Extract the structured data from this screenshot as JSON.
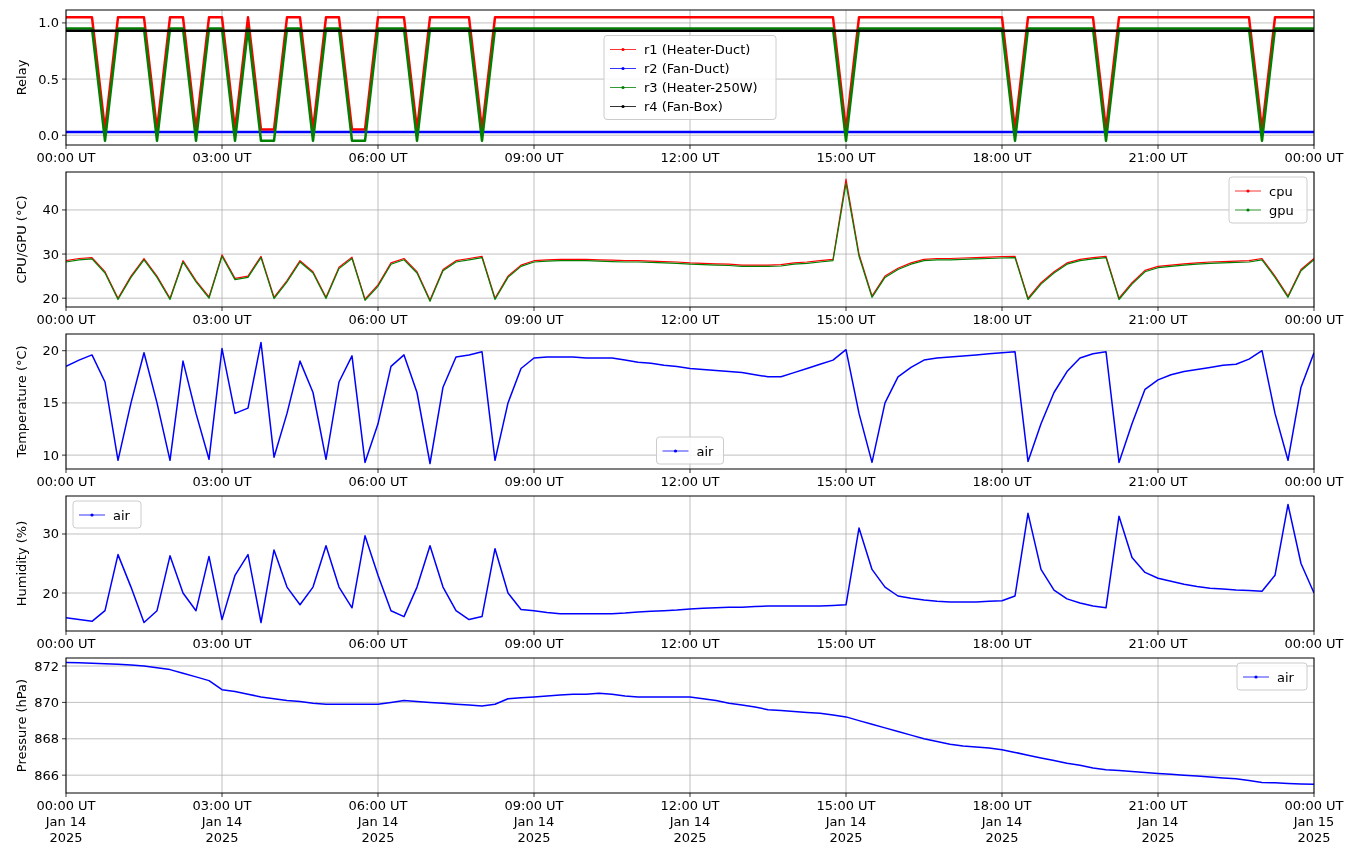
{
  "panels": [
    {
      "chart_data": {
        "type": "line",
        "grid": true,
        "legend": true,
        "ylabel": "Relay",
        "ylim": [
          -0.087,
          1.115
        ],
        "categories": [
          "00:00 UT",
          null,
          null,
          null,
          null,
          null,
          null,
          null,
          null,
          null,
          null,
          null,
          "03:00 UT",
          null,
          null,
          null,
          null,
          null,
          null,
          null,
          null,
          null,
          null,
          null,
          "06:00 UT",
          null,
          null,
          null,
          null,
          null,
          null,
          null,
          null,
          null,
          null,
          null,
          "09:00 UT",
          null,
          null,
          null,
          null,
          null,
          null,
          null,
          null,
          null,
          null,
          null,
          "12:00 UT",
          null,
          null,
          null,
          null,
          null,
          null,
          null,
          null,
          null,
          null,
          null,
          "15:00 UT",
          null,
          null,
          null,
          null,
          null,
          null,
          null,
          null,
          null,
          null,
          null,
          "18:00 UT",
          null,
          null,
          null,
          null,
          null,
          null,
          null,
          null,
          null,
          null,
          null,
          "21:00 UT",
          null,
          null,
          null,
          null,
          null,
          null,
          null,
          null,
          null,
          null,
          null,
          "00:00 UT"
        ],
        "yticks": [
          {
            "value": 0,
            "label": "0.0"
          },
          {
            "value": 0.5,
            "label": "0.5"
          },
          {
            "value": 1,
            "label": "1.0"
          }
        ],
        "series": [
          {
            "name": "r1 (Heater-Duct)",
            "color": "#ff0000",
            "values": [
              1.05,
              1.05,
              1.05,
              0.05,
              1.05,
              1.05,
              1.05,
              0.05,
              1.05,
              1.05,
              0.05,
              1.05,
              1.05,
              0.05,
              1.05,
              0.05,
              0.05,
              1.05,
              1.05,
              0.05,
              1.05,
              1.05,
              0.05,
              0.05,
              1.05,
              1.05,
              1.05,
              0.05,
              1.05,
              1.05,
              1.05,
              1.05,
              0.05,
              1.05,
              1.05,
              1.05,
              1.05,
              1.05,
              1.05,
              1.05,
              1.05,
              1.05,
              1.05,
              1.05,
              1.05,
              1.05,
              1.05,
              1.05,
              1.05,
              1.05,
              1.05,
              1.05,
              1.05,
              1.05,
              1.05,
              1.05,
              1.05,
              1.05,
              1.05,
              1.05,
              0.05,
              1.05,
              1.05,
              1.05,
              1.05,
              1.05,
              1.05,
              1.05,
              1.05,
              1.05,
              1.05,
              1.05,
              1.05,
              0.05,
              1.05,
              1.05,
              1.05,
              1.05,
              1.05,
              1.05,
              0.05,
              1.05,
              1.05,
              1.05,
              1.05,
              1.05,
              1.05,
              1.05,
              1.05,
              1.05,
              1.05,
              1.05,
              0.05,
              1.05,
              1.05,
              1.05,
              1.05
            ]
          },
          {
            "name": "r2 (Fan-Duct)",
            "color": "#0000ff",
            "values": [
              0.03,
              0.03,
              0.03,
              0.03,
              0.03,
              0.03,
              0.03,
              0.03,
              0.03,
              0.03,
              0.03,
              0.03,
              0.03,
              0.03,
              0.03,
              0.03,
              0.03,
              0.03,
              0.03,
              0.03,
              0.03,
              0.03,
              0.03,
              0.03,
              0.03,
              0.03,
              0.03,
              0.03,
              0.03,
              0.03,
              0.03,
              0.03,
              0.03,
              0.03,
              0.03,
              0.03,
              0.03,
              0.03,
              0.03,
              0.03,
              0.03,
              0.03,
              0.03,
              0.03,
              0.03,
              0.03,
              0.03,
              0.03,
              0.03,
              0.03,
              0.03,
              0.03,
              0.03,
              0.03,
              0.03,
              0.03,
              0.03,
              0.03,
              0.03,
              0.03,
              0.03,
              0.03,
              0.03,
              0.03,
              0.03,
              0.03,
              0.03,
              0.03,
              0.03,
              0.03,
              0.03,
              0.03,
              0.03,
              0.03,
              0.03,
              0.03,
              0.03,
              0.03,
              0.03,
              0.03,
              0.03,
              0.03,
              0.03,
              0.03,
              0.03,
              0.03,
              0.03,
              0.03,
              0.03,
              0.03,
              0.03,
              0.03,
              0.03,
              0.03,
              0.03,
              0.03,
              0.03
            ]
          },
          {
            "name": "r3 (Heater-250W)",
            "color": "#008000",
            "values": [
              0.95,
              0.95,
              0.95,
              -0.05,
              0.95,
              0.95,
              0.95,
              -0.05,
              0.95,
              0.95,
              -0.05,
              0.95,
              0.95,
              -0.05,
              0.95,
              -0.05,
              -0.05,
              0.95,
              0.95,
              -0.05,
              0.95,
              0.95,
              -0.05,
              -0.05,
              0.95,
              0.95,
              0.95,
              -0.05,
              0.95,
              0.95,
              0.95,
              0.95,
              -0.05,
              0.95,
              0.95,
              0.95,
              0.95,
              0.95,
              0.95,
              0.95,
              0.95,
              0.95,
              0.95,
              0.95,
              0.95,
              0.95,
              0.95,
              0.95,
              0.95,
              0.95,
              0.95,
              0.95,
              0.95,
              0.95,
              0.95,
              0.95,
              0.95,
              0.95,
              0.95,
              0.95,
              -0.05,
              0.95,
              0.95,
              0.95,
              0.95,
              0.95,
              0.95,
              0.95,
              0.95,
              0.95,
              0.95,
              0.95,
              0.95,
              -0.05,
              0.95,
              0.95,
              0.95,
              0.95,
              0.95,
              0.95,
              -0.05,
              0.95,
              0.95,
              0.95,
              0.95,
              0.95,
              0.95,
              0.95,
              0.95,
              0.95,
              0.95,
              0.95,
              -0.05,
              0.95,
              0.95,
              0.95,
              0.95
            ]
          },
          {
            "name": "r4 (Fan-Box)",
            "color": "#000000",
            "values": [
              0.93,
              0.93,
              0.93,
              0.93,
              0.93,
              0.93,
              0.93,
              0.93,
              0.93,
              0.93,
              0.93,
              0.93,
              0.93,
              0.93,
              0.93,
              0.93,
              0.93,
              0.93,
              0.93,
              0.93,
              0.93,
              0.93,
              0.93,
              0.93,
              0.93,
              0.93,
              0.93,
              0.93,
              0.93,
              0.93,
              0.93,
              0.93,
              0.93,
              0.93,
              0.93,
              0.93,
              0.93,
              0.93,
              0.93,
              0.93,
              0.93,
              0.93,
              0.93,
              0.93,
              0.93,
              0.93,
              0.93,
              0.93,
              0.93,
              0.93,
              0.93,
              0.93,
              0.93,
              0.93,
              0.93,
              0.93,
              0.93,
              0.93,
              0.93,
              0.93,
              0.93,
              0.93,
              0.93,
              0.93,
              0.93,
              0.93,
              0.93,
              0.93,
              0.93,
              0.93,
              0.93,
              0.93,
              0.93,
              0.93,
              0.93,
              0.93,
              0.93,
              0.93,
              0.93,
              0.93,
              0.93,
              0.93,
              0.93,
              0.93,
              0.93,
              0.93,
              0.93,
              0.93,
              0.93,
              0.93,
              0.93,
              0.93,
              0.93,
              0.93,
              0.93,
              0.93,
              0.93
            ]
          }
        ]
      }
    },
    {
      "chart_data": {
        "type": "line",
        "grid": true,
        "legend": true,
        "ylabel": "CPU/GPU (°C)",
        "ylim": [
          18.0,
          48.6
        ],
        "categories": [
          "00:00 UT",
          null,
          null,
          null,
          null,
          null,
          null,
          null,
          null,
          null,
          null,
          null,
          "03:00 UT",
          null,
          null,
          null,
          null,
          null,
          null,
          null,
          null,
          null,
          null,
          null,
          "06:00 UT",
          null,
          null,
          null,
          null,
          null,
          null,
          null,
          null,
          null,
          null,
          null,
          "09:00 UT",
          null,
          null,
          null,
          null,
          null,
          null,
          null,
          null,
          null,
          null,
          null,
          "12:00 UT",
          null,
          null,
          null,
          null,
          null,
          null,
          null,
          null,
          null,
          null,
          null,
          "15:00 UT",
          null,
          null,
          null,
          null,
          null,
          null,
          null,
          null,
          null,
          null,
          null,
          "18:00 UT",
          null,
          null,
          null,
          null,
          null,
          null,
          null,
          null,
          null,
          null,
          null,
          "21:00 UT",
          null,
          null,
          null,
          null,
          null,
          null,
          null,
          null,
          null,
          null,
          null,
          "00:00 UT"
        ],
        "yticks": [
          20,
          30,
          40
        ],
        "series": [
          {
            "name": "cpu",
            "color": "#ff0000",
            "values": [
              28.5,
              29,
              29.2,
              26,
              20,
              25,
              29,
              25,
              20,
              28.5,
              24,
              20.3,
              29.8,
              24.5,
              25,
              29.5,
              20.2,
              24,
              28.5,
              26,
              20.2,
              27,
              29.3,
              19.8,
              23,
              28,
              29,
              26,
              19.6,
              26.5,
              28.5,
              29,
              29.5,
              20,
              25,
              27.5,
              28.5,
              28.7,
              28.8,
              28.8,
              28.8,
              28.7,
              28.6,
              28.5,
              28.5,
              28.4,
              28.3,
              28.2,
              28,
              27.9,
              27.8,
              27.7,
              27.5,
              27.5,
              27.5,
              27.6,
              28,
              28.2,
              28.5,
              28.8,
              47,
              30,
              20.5,
              25,
              26.8,
              28,
              28.8,
              29,
              29,
              29.1,
              29.2,
              29.3,
              29.4,
              29.5,
              20,
              23.5,
              26,
              28,
              28.8,
              29.2,
              29.5,
              20,
              23.5,
              26.3,
              27.2,
              27.5,
              27.8,
              28,
              28.2,
              28.3,
              28.4,
              28.5,
              29,
              25,
              20.5,
              26.5,
              29
            ]
          },
          {
            "name": "gpu",
            "color": "#008000",
            "values": [
              28.2,
              28.7,
              28.9,
              25.7,
              19.7,
              24.7,
              28.7,
              24.7,
              19.7,
              28.2,
              23.7,
              20,
              29.5,
              24.2,
              24.7,
              29.2,
              19.9,
              23.7,
              28.2,
              25.7,
              19.9,
              26.7,
              29,
              19.5,
              22.7,
              27.7,
              28.7,
              25.7,
              19.3,
              26.2,
              28.2,
              28.7,
              29.2,
              19.7,
              24.7,
              27.2,
              28.2,
              28.4,
              28.5,
              28.5,
              28.5,
              28.4,
              28.3,
              28.2,
              28.2,
              28.1,
              28,
              27.9,
              27.7,
              27.6,
              27.5,
              27.4,
              27.2,
              27.2,
              27.2,
              27.3,
              27.7,
              27.9,
              28.2,
              28.5,
              46,
              29.5,
              20.2,
              24.7,
              26.5,
              27.7,
              28.5,
              28.7,
              28.7,
              28.8,
              28.9,
              29,
              29.1,
              29.2,
              19.7,
              23.2,
              25.7,
              27.7,
              28.5,
              28.9,
              29.2,
              19.7,
              23.2,
              26,
              26.9,
              27.2,
              27.5,
              27.7,
              27.9,
              28,
              28.1,
              28.2,
              28.7,
              24.7,
              20.2,
              26.2,
              28.7
            ]
          }
        ]
      }
    },
    {
      "chart_data": {
        "type": "line",
        "grid": true,
        "legend": true,
        "ylabel": "Temperature (°C)",
        "ylim": [
          8.67,
          21.6
        ],
        "categories": [
          "00:00 UT",
          null,
          null,
          null,
          null,
          null,
          null,
          null,
          null,
          null,
          null,
          null,
          "03:00 UT",
          null,
          null,
          null,
          null,
          null,
          null,
          null,
          null,
          null,
          null,
          null,
          "06:00 UT",
          null,
          null,
          null,
          null,
          null,
          null,
          null,
          null,
          null,
          null,
          null,
          "09:00 UT",
          null,
          null,
          null,
          null,
          null,
          null,
          null,
          null,
          null,
          null,
          null,
          "12:00 UT",
          null,
          null,
          null,
          null,
          null,
          null,
          null,
          null,
          null,
          null,
          null,
          "15:00 UT",
          null,
          null,
          null,
          null,
          null,
          null,
          null,
          null,
          null,
          null,
          null,
          "18:00 UT",
          null,
          null,
          null,
          null,
          null,
          null,
          null,
          null,
          null,
          null,
          null,
          "21:00 UT",
          null,
          null,
          null,
          null,
          null,
          null,
          null,
          null,
          null,
          null,
          null,
          "00:00 UT"
        ],
        "yticks": [
          10,
          15,
          20
        ],
        "series": [
          {
            "name": "air",
            "color": "#0000ff",
            "values": [
              18.5,
              19.1,
              19.6,
              17,
              9.5,
              15,
              19.8,
              15,
              9.5,
              19,
              14,
              9.6,
              20.2,
              14,
              14.5,
              20.8,
              9.8,
              14,
              19,
              16,
              9.6,
              17,
              19.5,
              9.3,
              13,
              18.5,
              19.6,
              16,
              9.2,
              16.5,
              19.4,
              19.6,
              19.9,
              9.5,
              15,
              18.3,
              19.3,
              19.4,
              19.4,
              19.4,
              19.3,
              19.3,
              19.3,
              19.1,
              18.9,
              18.8,
              18.6,
              18.5,
              18.3,
              18.2,
              18.1,
              18,
              17.9,
              17.7,
              17.5,
              17.5,
              17.9,
              18.3,
              18.7,
              19.1,
              20.1,
              14,
              9.3,
              15,
              17.5,
              18.4,
              19.1,
              19.3,
              19.4,
              19.5,
              19.6,
              19.7,
              19.8,
              19.9,
              9.4,
              13,
              16,
              18,
              19.3,
              19.7,
              19.9,
              9.3,
              13,
              16.3,
              17.2,
              17.7,
              18,
              18.2,
              18.4,
              18.6,
              18.7,
              19.2,
              20,
              14,
              9.5,
              16.5,
              19.8
            ]
          }
        ]
      }
    },
    {
      "chart_data": {
        "type": "line",
        "grid": true,
        "legend": true,
        "ylabel": "Humidity (%)",
        "ylim": [
          13.56,
          36.44
        ],
        "categories": [
          "00:00 UT",
          null,
          null,
          null,
          null,
          null,
          null,
          null,
          null,
          null,
          null,
          null,
          "03:00 UT",
          null,
          null,
          null,
          null,
          null,
          null,
          null,
          null,
          null,
          null,
          null,
          "06:00 UT",
          null,
          null,
          null,
          null,
          null,
          null,
          null,
          null,
          null,
          null,
          null,
          "09:00 UT",
          null,
          null,
          null,
          null,
          null,
          null,
          null,
          null,
          null,
          null,
          null,
          "12:00 UT",
          null,
          null,
          null,
          null,
          null,
          null,
          null,
          null,
          null,
          null,
          null,
          "15:00 UT",
          null,
          null,
          null,
          null,
          null,
          null,
          null,
          null,
          null,
          null,
          null,
          "18:00 UT",
          null,
          null,
          null,
          null,
          null,
          null,
          null,
          null,
          null,
          null,
          null,
          "21:00 UT",
          null,
          null,
          null,
          null,
          null,
          null,
          null,
          null,
          null,
          null,
          null,
          "00:00 UT"
        ],
        "yticks": [
          20,
          30
        ],
        "series": [
          {
            "name": "air",
            "color": "#0000ff",
            "values": [
              15.8,
              15.5,
              15.2,
              17,
              26.5,
              21,
              15,
              17,
              26.3,
              20,
              17,
              26.2,
              15.5,
              23,
              26.5,
              15,
              27.3,
              21,
              18,
              21,
              28,
              21,
              17.5,
              29.7,
              23,
              17,
              16,
              21,
              28,
              21,
              17,
              15.5,
              16,
              27.5,
              20,
              17.2,
              17,
              16.7,
              16.5,
              16.5,
              16.5,
              16.5,
              16.5,
              16.6,
              16.8,
              16.9,
              17,
              17.1,
              17.3,
              17.4,
              17.5,
              17.6,
              17.6,
              17.7,
              17.8,
              17.8,
              17.8,
              17.8,
              17.8,
              17.9,
              18,
              31,
              24,
              21,
              19.5,
              19.1,
              18.8,
              18.6,
              18.5,
              18.5,
              18.5,
              18.6,
              18.7,
              19.5,
              33.5,
              24,
              20.5,
              19,
              18.3,
              17.8,
              17.5,
              33,
              26,
              23.5,
              22.5,
              22,
              21.5,
              21.1,
              20.8,
              20.7,
              20.5,
              20.4,
              20.3,
              23,
              35,
              25,
              20
            ]
          }
        ]
      }
    },
    {
      "chart_data": {
        "type": "line",
        "grid": true,
        "legend": true,
        "ylabel": "Pressure (hPa)",
        "ylim": [
          865.02,
          872.44
        ],
        "categories": [
          "00:00 UT\nJan 14\n2025",
          null,
          null,
          null,
          null,
          null,
          null,
          null,
          null,
          null,
          null,
          null,
          "03:00 UT\nJan 14\n2025",
          null,
          null,
          null,
          null,
          null,
          null,
          null,
          null,
          null,
          null,
          null,
          "06:00 UT\nJan 14\n2025",
          null,
          null,
          null,
          null,
          null,
          null,
          null,
          null,
          null,
          null,
          null,
          "09:00 UT\nJan 14\n2025",
          null,
          null,
          null,
          null,
          null,
          null,
          null,
          null,
          null,
          null,
          null,
          "12:00 UT\nJan 14\n2025",
          null,
          null,
          null,
          null,
          null,
          null,
          null,
          null,
          null,
          null,
          null,
          "15:00 UT\nJan 14\n2025",
          null,
          null,
          null,
          null,
          null,
          null,
          null,
          null,
          null,
          null,
          null,
          "18:00 UT\nJan 14\n2025",
          null,
          null,
          null,
          null,
          null,
          null,
          null,
          null,
          null,
          null,
          null,
          "21:00 UT\nJan 14\n2025",
          null,
          null,
          null,
          null,
          null,
          null,
          null,
          null,
          null,
          null,
          null,
          "00:00 UT\nJan 15\n2025"
        ],
        "yticks": [
          866,
          868,
          870,
          872
        ],
        "series": [
          {
            "name": "air",
            "color": "#0000ff",
            "values": [
              872.2,
              872.18,
              872.15,
              872.12,
              872.1,
              872.05,
              872.0,
              871.9,
              871.8,
              871.6,
              871.4,
              871.2,
              870.7,
              870.6,
              870.45,
              870.3,
              870.2,
              870.1,
              870.05,
              869.95,
              869.9,
              869.9,
              869.9,
              869.9,
              869.9,
              870.0,
              870.1,
              870.05,
              870.0,
              869.95,
              869.9,
              869.85,
              869.8,
              869.9,
              870.2,
              870.25,
              870.3,
              870.35,
              870.4,
              870.45,
              870.45,
              870.5,
              870.45,
              870.35,
              870.3,
              870.3,
              870.3,
              870.3,
              870.3,
              870.2,
              870.1,
              869.95,
              869.85,
              869.75,
              869.6,
              869.55,
              869.5,
              869.45,
              869.4,
              869.3,
              869.2,
              869.0,
              868.8,
              868.6,
              868.4,
              868.2,
              868.0,
              867.85,
              867.7,
              867.6,
              867.55,
              867.5,
              867.4,
              867.25,
              867.1,
              866.95,
              866.8,
              866.65,
              866.55,
              866.4,
              866.3,
              866.25,
              866.2,
              866.15,
              866.1,
              866.05,
              866.0,
              865.95,
              865.9,
              865.85,
              865.8,
              865.7,
              865.6,
              865.58,
              865.55,
              865.52,
              865.5
            ]
          }
        ]
      }
    }
  ]
}
